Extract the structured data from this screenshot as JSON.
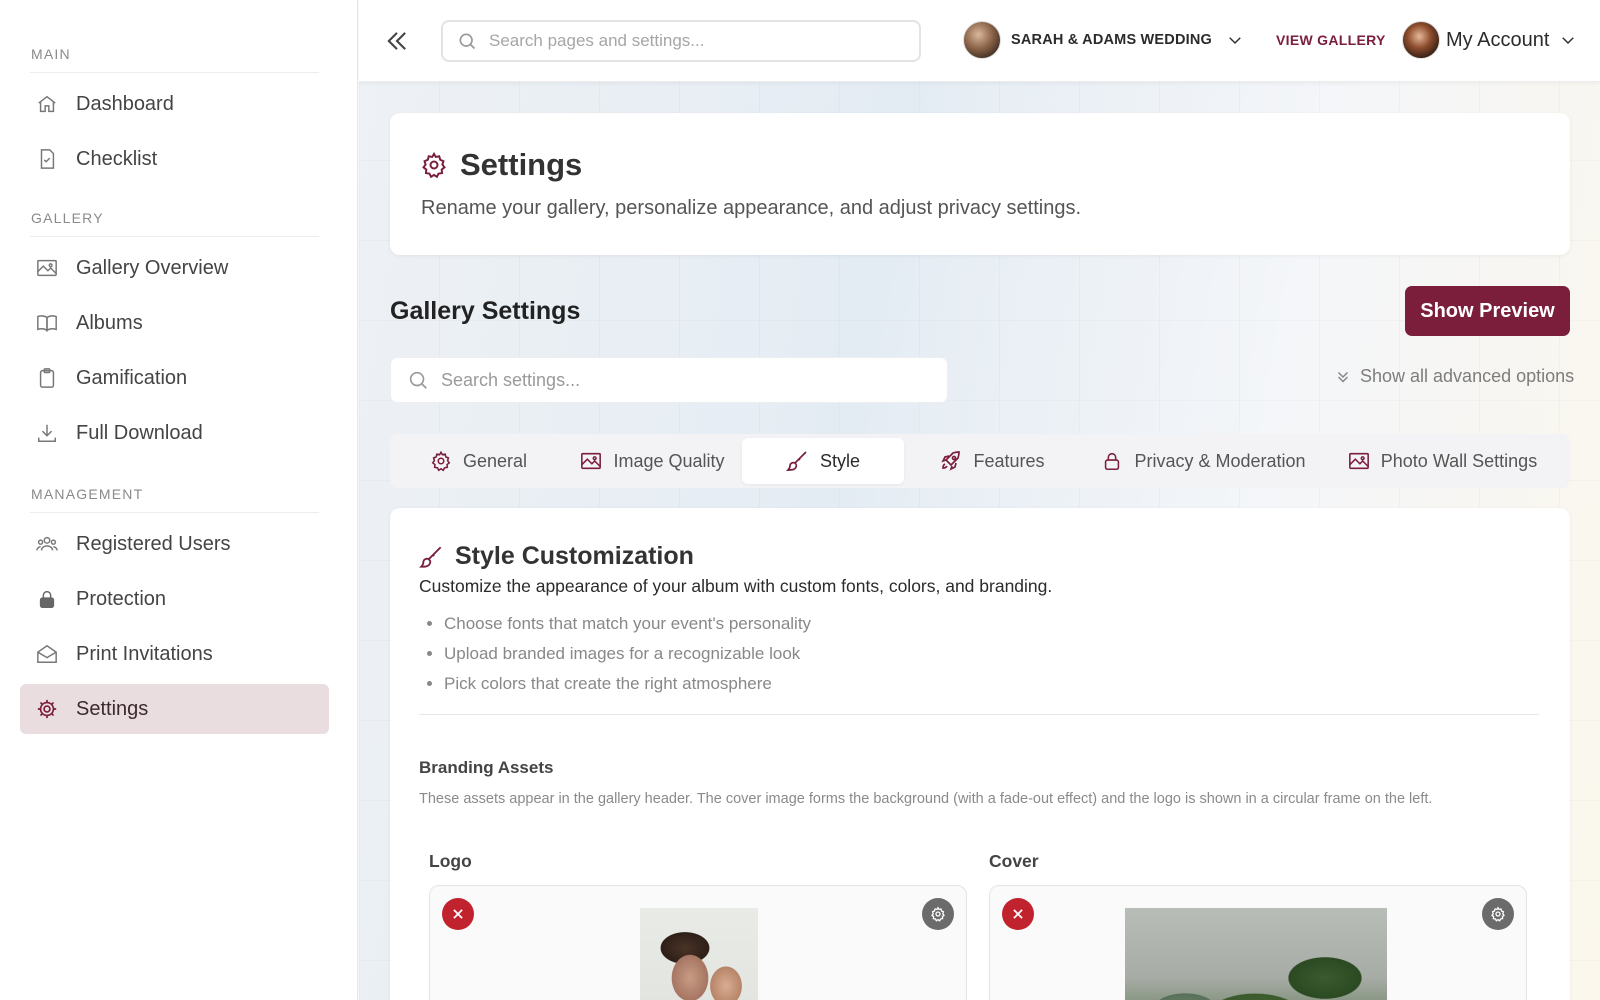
{
  "sidebar": {
    "sections": [
      {
        "title": "MAIN",
        "items": [
          {
            "label": "Dashboard",
            "icon": "home-icon"
          },
          {
            "label": "Checklist",
            "icon": "checklist-icon"
          }
        ]
      },
      {
        "title": "GALLERY",
        "items": [
          {
            "label": "Gallery Overview",
            "icon": "image-icon"
          },
          {
            "label": "Albums",
            "icon": "book-icon"
          },
          {
            "label": "Gamification",
            "icon": "clipboard-icon"
          },
          {
            "label": "Full Download",
            "icon": "download-icon"
          }
        ]
      },
      {
        "title": "MANAGEMENT",
        "items": [
          {
            "label": "Registered Users",
            "icon": "users-icon"
          },
          {
            "label": "Protection",
            "icon": "lock-icon"
          },
          {
            "label": "Print Invitations",
            "icon": "envelope-icon"
          },
          {
            "label": "Settings",
            "icon": "gear-icon",
            "active": true
          }
        ]
      }
    ]
  },
  "topbar": {
    "search_placeholder": "Search pages and settings...",
    "gallery_name": "SARAH & ADAMS WEDDING",
    "view_gallery": "VIEW GALLERY",
    "account_label": "My Account"
  },
  "header": {
    "title": "Settings",
    "subtitle": "Rename your gallery, personalize appearance, and adjust privacy settings."
  },
  "gallery_settings": {
    "title": "Gallery Settings",
    "preview_button": "Show Preview",
    "search_placeholder": "Search settings...",
    "advanced_toggle": "Show all advanced options"
  },
  "tabs": [
    {
      "label": "General",
      "icon": "gear-icon"
    },
    {
      "label": "Image Quality",
      "icon": "image-icon"
    },
    {
      "label": "Style",
      "icon": "brush-icon",
      "active": true
    },
    {
      "label": "Features",
      "icon": "rocket-icon"
    },
    {
      "label": "Privacy & Moderation",
      "icon": "lock-icon"
    },
    {
      "label": "Photo Wall Settings",
      "icon": "image-icon"
    }
  ],
  "style_panel": {
    "title": "Style Customization",
    "description": "Customize the appearance of your album with custom fonts, colors, and branding.",
    "bullets": [
      "Choose fonts that match your event's personality",
      "Upload branded images for a recognizable look",
      "Pick colors that create the right atmosphere"
    ],
    "branding_title": "Branding Assets",
    "branding_description": "These assets appear in the gallery header. The cover image forms the background (with a fade-out effect) and the logo is shown in a circular frame on the left.",
    "logo_label": "Logo",
    "cover_label": "Cover"
  },
  "colors": {
    "accent": "#7a1e3c",
    "active_nav_bg": "#eadde0",
    "remove": "#c0232e"
  }
}
